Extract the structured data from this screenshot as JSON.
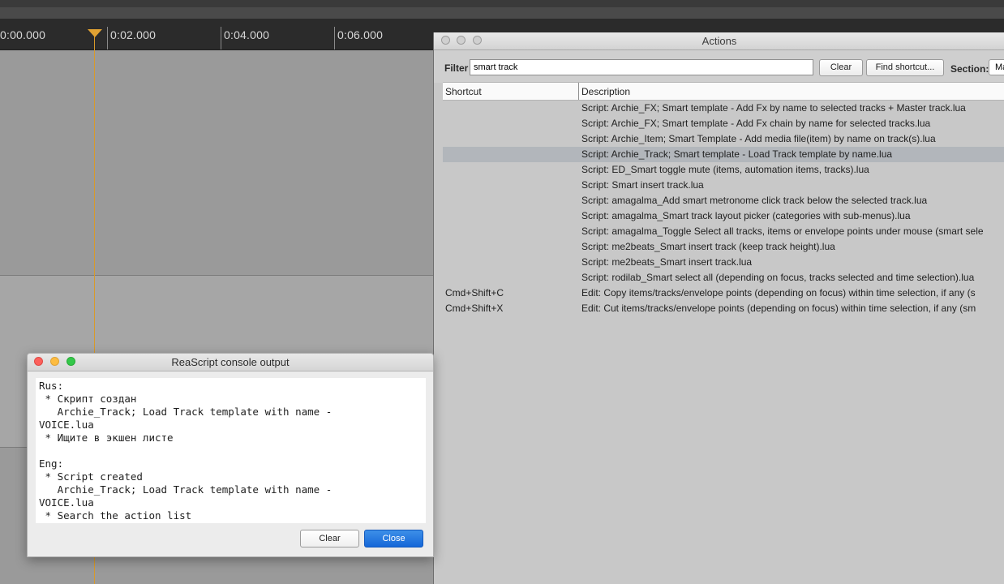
{
  "ruler": {
    "labels": [
      "0:00.000",
      "0:02.000",
      "0:04.000",
      "0:06.000"
    ]
  },
  "actions": {
    "title": "Actions",
    "filter_label": "Filter",
    "filter_value": "smart track",
    "clear_label": "Clear",
    "find_shortcut_label": "Find shortcut...",
    "section_label": "Section:",
    "section_value": "Ma",
    "columns": {
      "shortcut": "Shortcut",
      "description": "Description"
    },
    "rows": [
      {
        "shortcut": "",
        "description": "Script: Archie_FX; Smart template - Add Fx by name to selected tracks + Master track.lua"
      },
      {
        "shortcut": "",
        "description": "Script: Archie_FX; Smart template - Add Fx chain by name for selected tracks.lua"
      },
      {
        "shortcut": "",
        "description": "Script: Archie_Item; Smart Template - Add media file(item) by name on track(s).lua"
      },
      {
        "shortcut": "",
        "description": "Script: Archie_Track; Smart template - Load Track template by name.lua"
      },
      {
        "shortcut": "",
        "description": "Script: ED_Smart toggle mute (items, automation items, tracks).lua"
      },
      {
        "shortcut": "",
        "description": "Script: Smart insert track.lua"
      },
      {
        "shortcut": "",
        "description": "Script: amagalma_Add smart metronome click track below the selected track.lua"
      },
      {
        "shortcut": "",
        "description": "Script: amagalma_Smart track layout picker (categories with sub-menus).lua"
      },
      {
        "shortcut": "",
        "description": "Script: amagalma_Toggle Select all tracks, items or envelope points under mouse (smart sele"
      },
      {
        "shortcut": "",
        "description": "Script: me2beats_Smart insert track (keep track height).lua"
      },
      {
        "shortcut": "",
        "description": "Script: me2beats_Smart insert track.lua"
      },
      {
        "shortcut": "",
        "description": "Script: rodilab_Smart select all (depending on focus, tracks selected and time selection).lua"
      },
      {
        "shortcut": "Cmd+Shift+C",
        "description": "Edit: Copy items/tracks/envelope points (depending on focus) within time selection, if any (s"
      },
      {
        "shortcut": "Cmd+Shift+X",
        "description": "Edit: Cut items/tracks/envelope points (depending on focus) within time selection, if any (sm"
      }
    ]
  },
  "console": {
    "title": "ReaScript console output",
    "lines": [
      "Rus:",
      " * Скрипт создан",
      "   Archie_Track; Load Track template with name -",
      "VOICE.lua",
      " * Ищите в экшен листе",
      "",
      "Eng:",
      " * Script created",
      "   Archie_Track; Load Track template with name -",
      "VOICE.lua",
      " * Search the action list"
    ],
    "clear_label": "Clear",
    "close_label": "Close"
  }
}
